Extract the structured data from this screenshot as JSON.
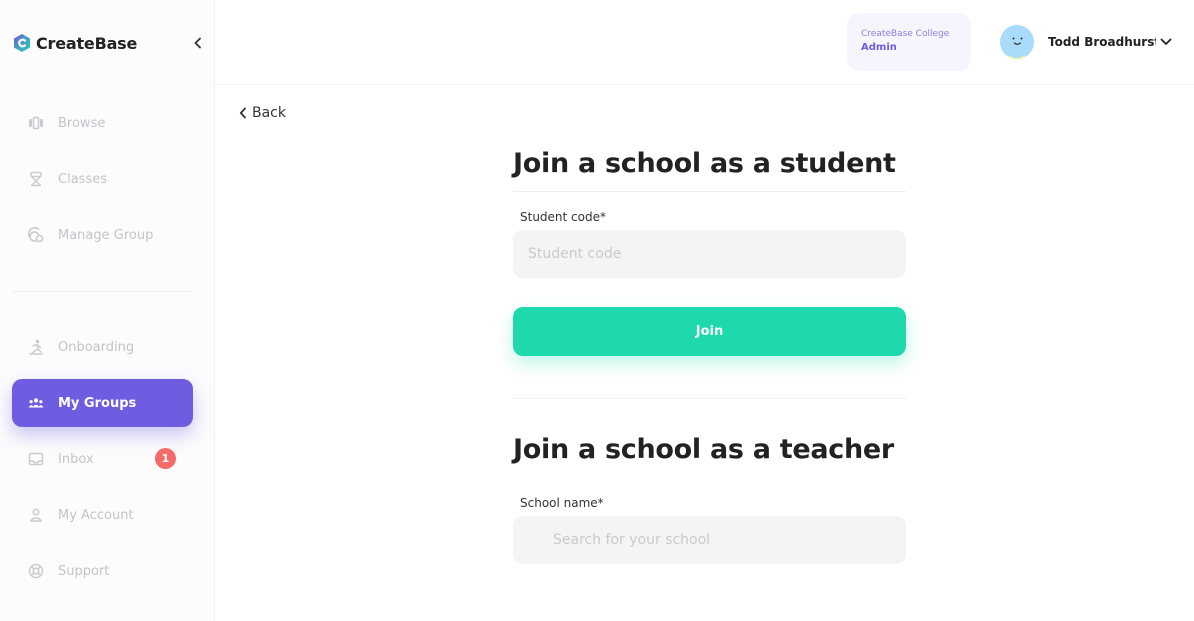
{
  "brand": {
    "name": "CreateBase"
  },
  "colors": {
    "accent": "#6e5de0",
    "join": "#1dd9ab",
    "badge": "#f36b6b"
  },
  "sidebar": {
    "collapse_icon": "chevron-left-icon",
    "items": [
      {
        "label": "Browse",
        "icon": "browse-icon"
      },
      {
        "label": "Classes",
        "icon": "classes-icon"
      },
      {
        "label": "Manage Group",
        "icon": "manage-group-icon"
      },
      {
        "label": "Onboarding",
        "icon": "onboarding-icon"
      },
      {
        "label": "My Groups",
        "icon": "groups-icon",
        "active": true
      },
      {
        "label": "Inbox",
        "icon": "inbox-icon",
        "badge": "1"
      },
      {
        "label": "My Account",
        "icon": "account-icon"
      },
      {
        "label": "Support",
        "icon": "support-icon"
      }
    ]
  },
  "header": {
    "org_name": "CreateBase College",
    "org_role": "Admin",
    "user_name": "Todd Broadhurst"
  },
  "main": {
    "back_label": "Back",
    "student": {
      "title": "Join a school as a student",
      "field_label": "Student code*",
      "placeholder": "Student code",
      "value": "",
      "button_label": "Join"
    },
    "teacher": {
      "title": "Join a school as a teacher",
      "field_label": "School name*",
      "placeholder": "Search for your school",
      "value": ""
    }
  }
}
